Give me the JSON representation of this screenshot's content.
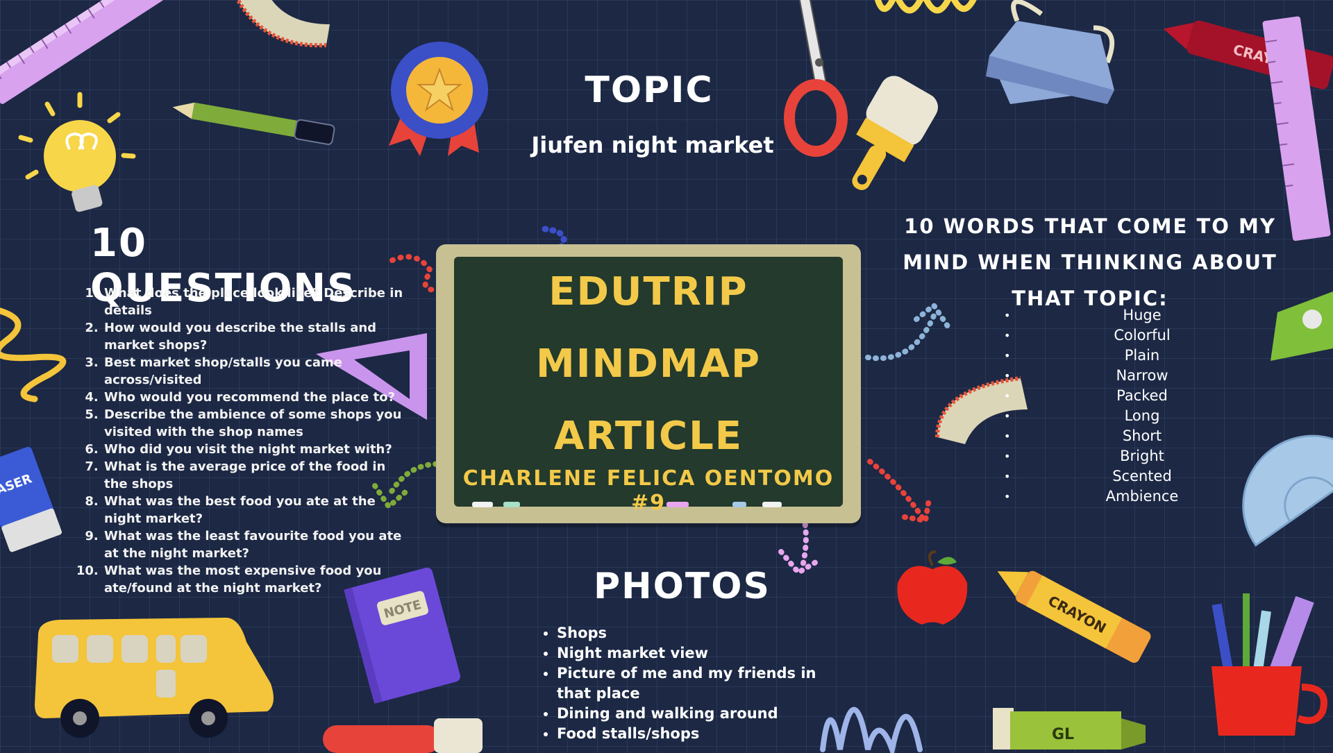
{
  "topic": {
    "heading": "TOPIC",
    "value": "Jiufen night market"
  },
  "board": {
    "line1": "EDUTRIP",
    "line2": "MINDMAP",
    "line3": "ARTICLE",
    "author": "CHARLENE FELICA OENTOMO #9"
  },
  "questions": {
    "heading": "10 QUESTIONS",
    "items": [
      "What does the place look like? Describe in details",
      "How would you describe the stalls and market shops?",
      "Best market shop/stalls you came across/visited",
      "Who would you recommend the place to?",
      "Describe the ambience of some shops you visited with the shop names",
      "Who did you visit the night market with?",
      "What is the average price of the food in the shops",
      "What was the best food you ate at the night market?",
      "What was the least favourite food you ate at the night market?",
      "What was the most expensive food you ate/found at the night market?"
    ]
  },
  "words": {
    "heading": "10 WORDS THAT COME TO MY MIND WHEN THINKING ABOUT THAT TOPIC:",
    "items": [
      "Huge",
      "Colorful",
      "Plain",
      "Narrow",
      "Packed",
      "Long",
      "Short",
      "Bright",
      "Scented",
      "Ambience"
    ]
  },
  "photos": {
    "heading": "PHOTOS",
    "items": [
      "Shops",
      "Night market view",
      "Picture of me and my friends in that place",
      "Dining and walking around",
      "Food stalls/shops"
    ]
  },
  "decor": {
    "crayon_red_label": "CRAYON",
    "crayon_yellow_label": "CRAYON",
    "notebook_label": "NOTE",
    "eraser_label": "ASER",
    "glue_label": "GL"
  },
  "colors": {
    "background": "#1c2844",
    "chalk_text": "#f3c94a",
    "board": "#233a2c",
    "board_frame": "#c7c093"
  }
}
